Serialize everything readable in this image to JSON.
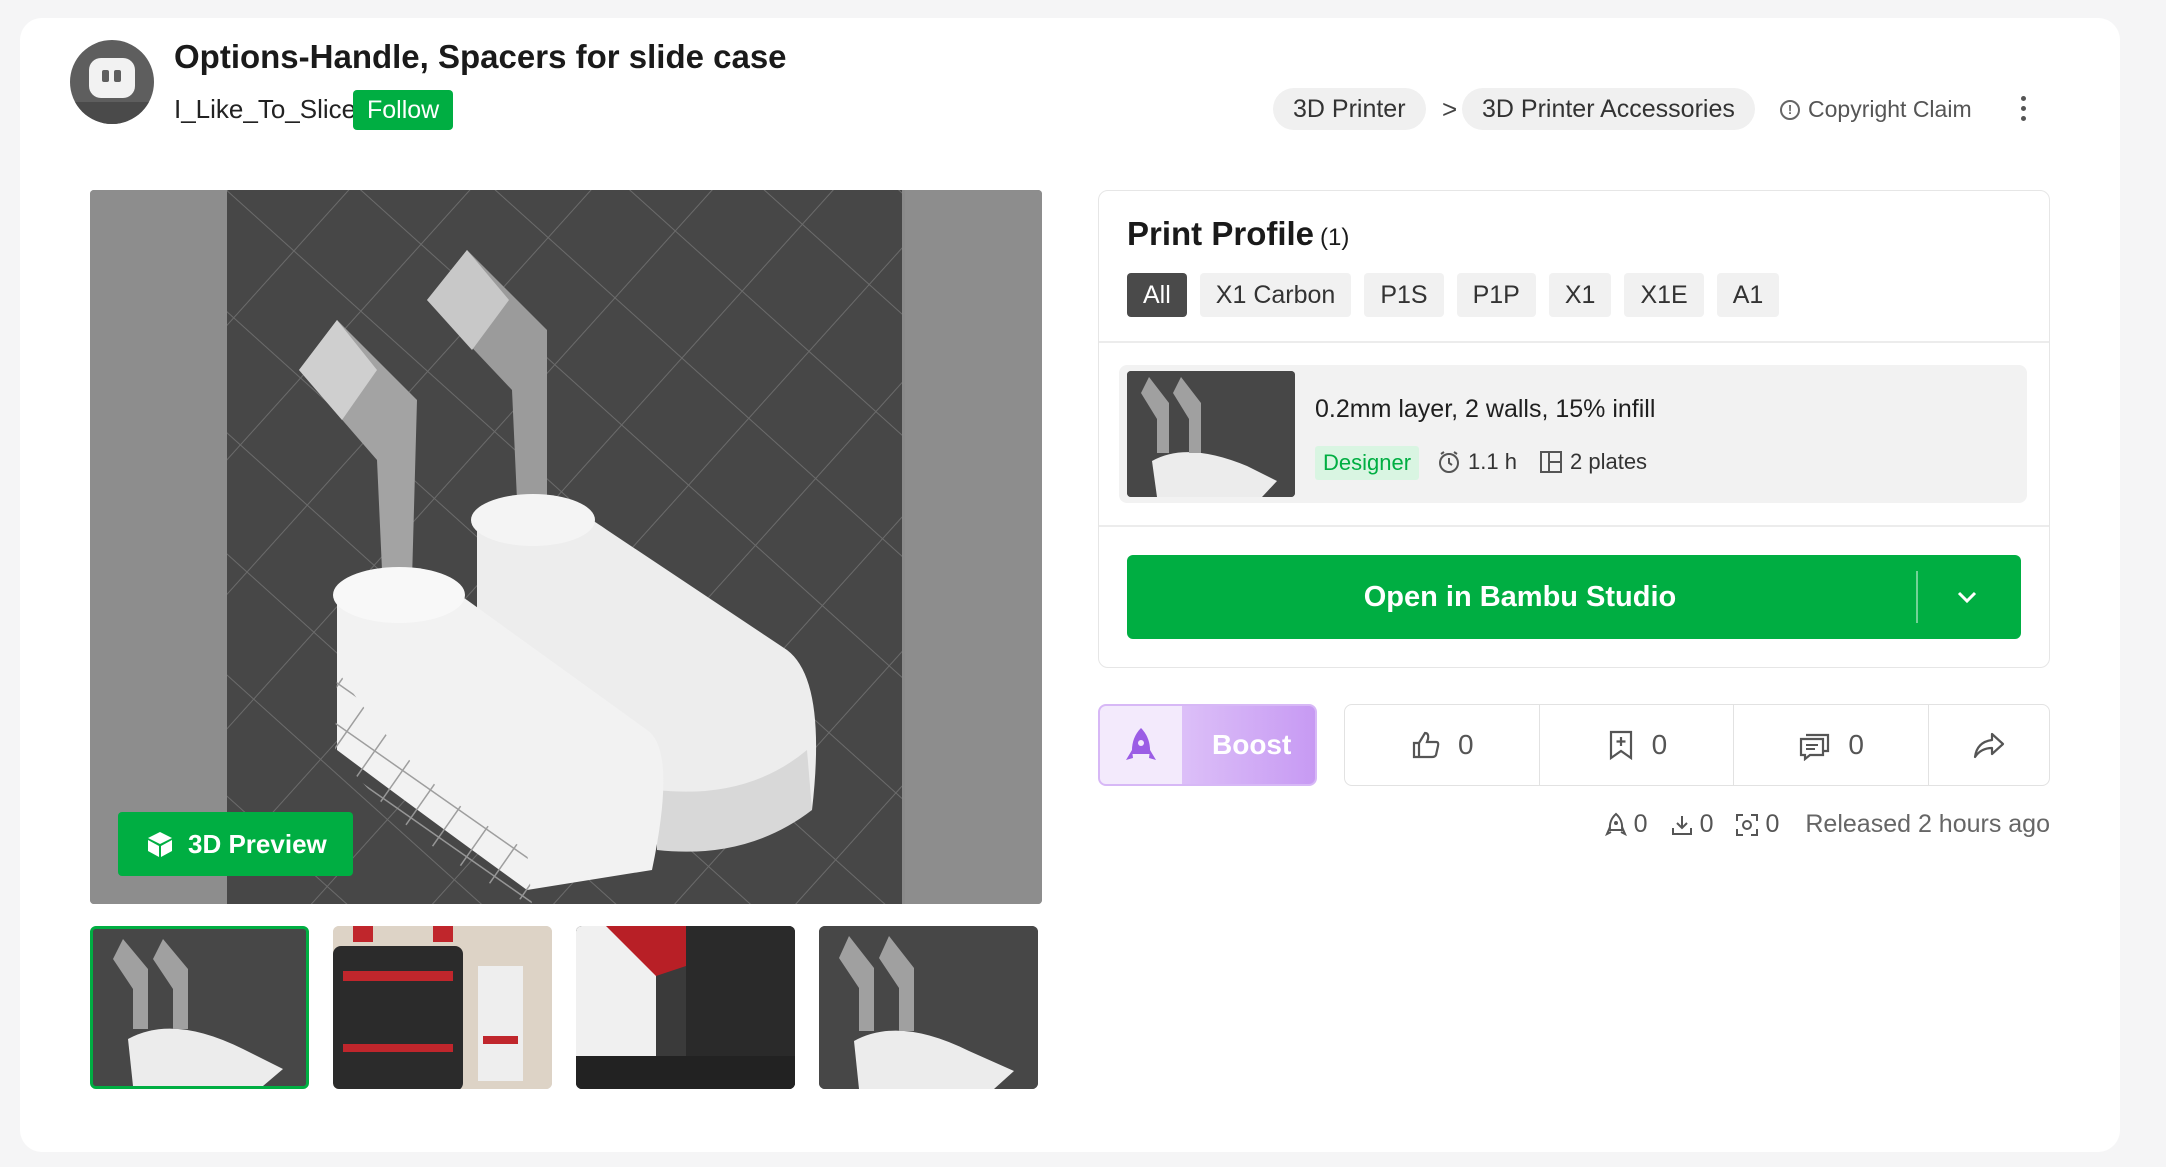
{
  "header": {
    "title": "Options-Handle, Spacers for slide case",
    "author": "I_Like_To_Slice",
    "follow_label": "Follow",
    "breadcrumbs": [
      "3D Printer",
      "3D Printer Accessories"
    ],
    "breadcrumb_separator": ">",
    "copyright_label": "Copyright Claim"
  },
  "gallery": {
    "preview_label": "3D Preview",
    "thumbnails": [
      "model-render",
      "case-photo",
      "case-closeup",
      "model-render"
    ]
  },
  "print_profile": {
    "title": "Print Profile",
    "count": "(1)",
    "filters": [
      "All",
      "X1 Carbon",
      "P1S",
      "P1P",
      "X1",
      "X1E",
      "A1"
    ],
    "selected_filter": "All",
    "profile": {
      "name": "0.2mm layer, 2 walls, 15% infill",
      "tag": "Designer",
      "time": "1.1 h",
      "plates": "2 plates"
    },
    "open_label": "Open in Bambu Studio"
  },
  "actions": {
    "boost_label": "Boost",
    "likes": "0",
    "collects": "0",
    "comments": "0"
  },
  "stats": {
    "boosts": "0",
    "downloads": "0",
    "prints": "0",
    "released": "Released 2 hours ago"
  },
  "colors": {
    "accent": "#00ae42",
    "boost": "#c79af3",
    "viewport": "#474747"
  }
}
